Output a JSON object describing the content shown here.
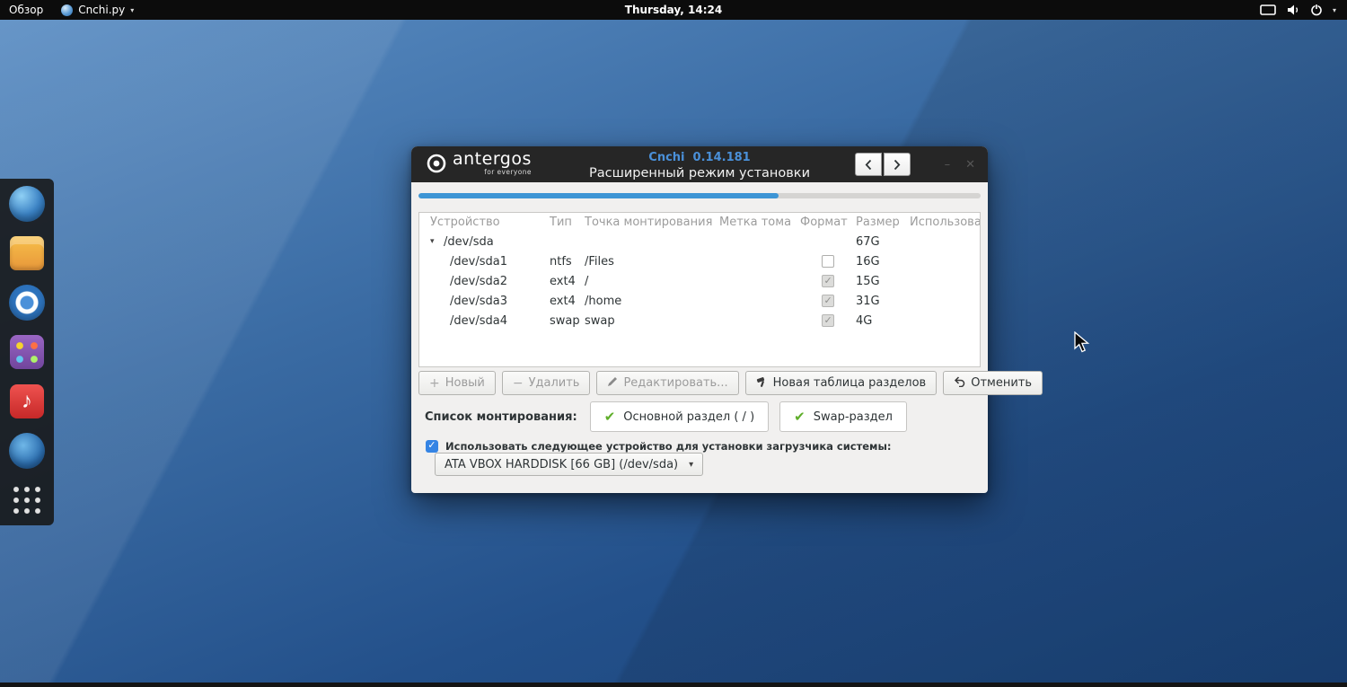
{
  "topbar": {
    "activities": "Обзор",
    "app_name": "Cnchi.py",
    "clock": "Thursday, 14:24",
    "right_icons": [
      "screen-icon",
      "volume-icon",
      "power-icon",
      "chevron-down-icon"
    ]
  },
  "dock": {
    "items": [
      {
        "name": "dock-item-browser",
        "icon": "globe-icon"
      },
      {
        "name": "dock-item-files",
        "icon": "files-icon"
      },
      {
        "name": "dock-item-chromium",
        "icon": "chromium-icon"
      },
      {
        "name": "dock-item-software",
        "icon": "software-icon"
      },
      {
        "name": "dock-item-music",
        "icon": "music-note-icon"
      },
      {
        "name": "dock-item-web",
        "icon": "globe2-icon"
      },
      {
        "name": "dock-item-show-apps",
        "icon": "apps-grid-icon"
      }
    ]
  },
  "window": {
    "brand": {
      "name": "antergos",
      "tagline": "for everyone"
    },
    "title": "Cnchi  0.14.181",
    "subtitle": "Расширенный режим установки",
    "progress_percent": 64,
    "nav": {
      "back": "‹",
      "forward": "›",
      "minimize": "–",
      "close": "✕"
    },
    "table": {
      "columns": [
        "Устройство",
        "Тип",
        "Точка монтирования",
        "Метка тома",
        "Формат",
        "Размер",
        "Использовано"
      ],
      "rows": [
        {
          "device": "/dev/sda",
          "type": "",
          "mount": "",
          "label": "",
          "format": null,
          "size": "67G",
          "used": "",
          "expander": true,
          "child": false
        },
        {
          "device": "/dev/sda1",
          "type": "ntfs",
          "mount": "/Files",
          "label": "",
          "format": "unchecked",
          "size": "16G",
          "used": "",
          "expander": false,
          "child": true
        },
        {
          "device": "/dev/sda2",
          "type": "ext4",
          "mount": "/",
          "label": "",
          "format": "checked_disabled",
          "size": "15G",
          "used": "",
          "expander": false,
          "child": true
        },
        {
          "device": "/dev/sda3",
          "type": "ext4",
          "mount": "/home",
          "label": "",
          "format": "checked_disabled",
          "size": "31G",
          "used": "",
          "expander": false,
          "child": true
        },
        {
          "device": "/dev/sda4",
          "type": "swap",
          "mount": "swap",
          "label": "",
          "format": "checked_disabled",
          "size": "4G",
          "used": "",
          "expander": false,
          "child": true
        }
      ]
    },
    "buttons": {
      "new": "Новый",
      "delete": "Удалить",
      "edit": "Редактировать...",
      "new_table": "Новая таблица разделов",
      "cancel": "Отменить"
    },
    "mount": {
      "label": "Список монтирования:",
      "badges": [
        "Основной раздел ( / )",
        "Swap-раздел"
      ]
    },
    "bootloader": {
      "checked": true,
      "label": "Использовать следующее устройство для установки загрузчика системы:",
      "device": "ATA VBOX HARDDISK [66 GB] (/dev/sda)"
    }
  },
  "colors": {
    "accent_blue": "#3d95d5",
    "title_blue": "#4a90d9",
    "check_green": "#5fae2a",
    "checkbox_blue": "#3584e4"
  }
}
